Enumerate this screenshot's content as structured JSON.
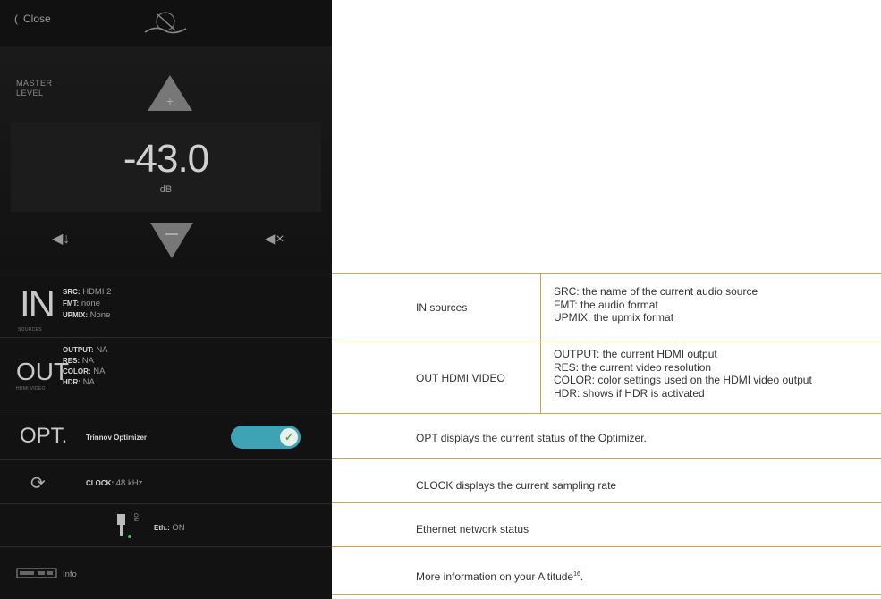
{
  "app": {
    "close_label": "Close",
    "master_label": "MASTER LEVEL",
    "volume_value": "-43.0",
    "volume_unit": "dB",
    "in_row": {
      "big": "IN",
      "sub": "SOURCES",
      "src_key": "SRC:",
      "src_val": "HDMI 2",
      "fmt_key": "FMT:",
      "fmt_val": "none",
      "upmix_key": "UPMIX:",
      "upmix_val": "None"
    },
    "out_row": {
      "big": "OUT",
      "sub": "HDMI VIDEO",
      "output_key": "OUTPUT:",
      "output_val": "NA",
      "res_key": "RES:",
      "res_val": "NA",
      "color_key": "COLOR:",
      "color_val": "NA",
      "hdr_key": "HDR:",
      "hdr_val": "NA"
    },
    "opt_row": {
      "big": "OPT.",
      "label": "Trinnov Optimizer",
      "toggle_on": true
    },
    "clock_row": {
      "key": "CLOCK:",
      "val": "48 kHz"
    },
    "eth_row": {
      "key": "Eth.:",
      "val": "ON",
      "plug_text": "ON"
    },
    "info_row": {
      "label": "Info"
    }
  },
  "table": {
    "rows": [
      {
        "name": "IN sources",
        "details": [
          "SRC: the name of the current audio source",
          "FMT: the audio format",
          "UPMIX: the upmix format"
        ]
      },
      {
        "name": "OUT HDMI VIDEO",
        "details": [
          "OUTPUT: the current HDMI output",
          "RES: the current video resolution",
          "COLOR: color settings used on the HDMI video output",
          "HDR: shows if HDR is activated"
        ]
      },
      {
        "text": "OPT displays the current status of the Optimizer."
      },
      {
        "text": "CLOCK displays the current sampling rate"
      },
      {
        "text": "Ethernet network status"
      },
      {
        "text": "More information on your Altitude",
        "sup": "16",
        "suffix": "."
      }
    ]
  },
  "colors": {
    "panel_bg": "#141414",
    "rule": "#c9a64e",
    "toggle": "#3ea4b5"
  }
}
